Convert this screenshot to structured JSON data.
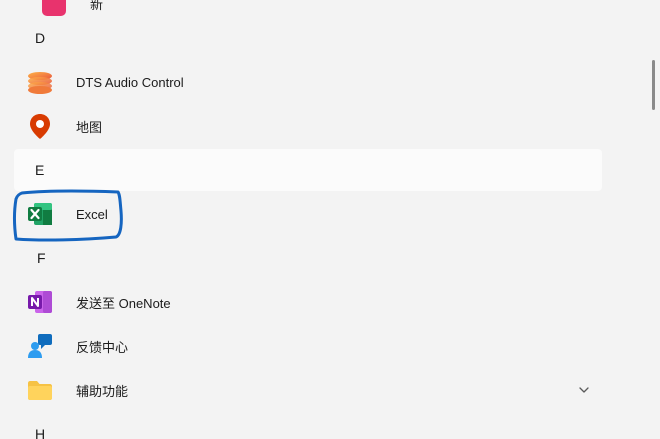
{
  "start_menu": {
    "all_apps": [
      {
        "type": "app",
        "label": "新",
        "icon": "pink-app-icon"
      },
      {
        "type": "letter",
        "label": "D"
      },
      {
        "type": "app",
        "label": "DTS Audio Control",
        "icon": "dts-audio-icon"
      },
      {
        "type": "app",
        "label": "地图",
        "icon": "maps-pin-icon"
      },
      {
        "type": "letter",
        "label": "E"
      },
      {
        "type": "app",
        "label": "Excel",
        "icon": "excel-icon"
      },
      {
        "type": "letter",
        "label": "F"
      },
      {
        "type": "app",
        "label": "发送至 OneNote",
        "icon": "onenote-icon"
      },
      {
        "type": "app",
        "label": "反馈中心",
        "icon": "feedback-hub-icon"
      },
      {
        "type": "folder",
        "label": "辅助功能",
        "icon": "folder-icon",
        "expand_icon": "chevron-down-icon"
      },
      {
        "type": "letter",
        "label": "H"
      }
    ]
  },
  "annotation": {
    "color": "#1565c0",
    "target": "Excel"
  },
  "colors": {
    "background": "#f3f3f3",
    "hover_row": "#fbfbfb",
    "excel_green": "#107c41",
    "onenote_purple": "#7719aa",
    "maps_red": "#d83b01",
    "folder_yellow": "#f6c244"
  }
}
